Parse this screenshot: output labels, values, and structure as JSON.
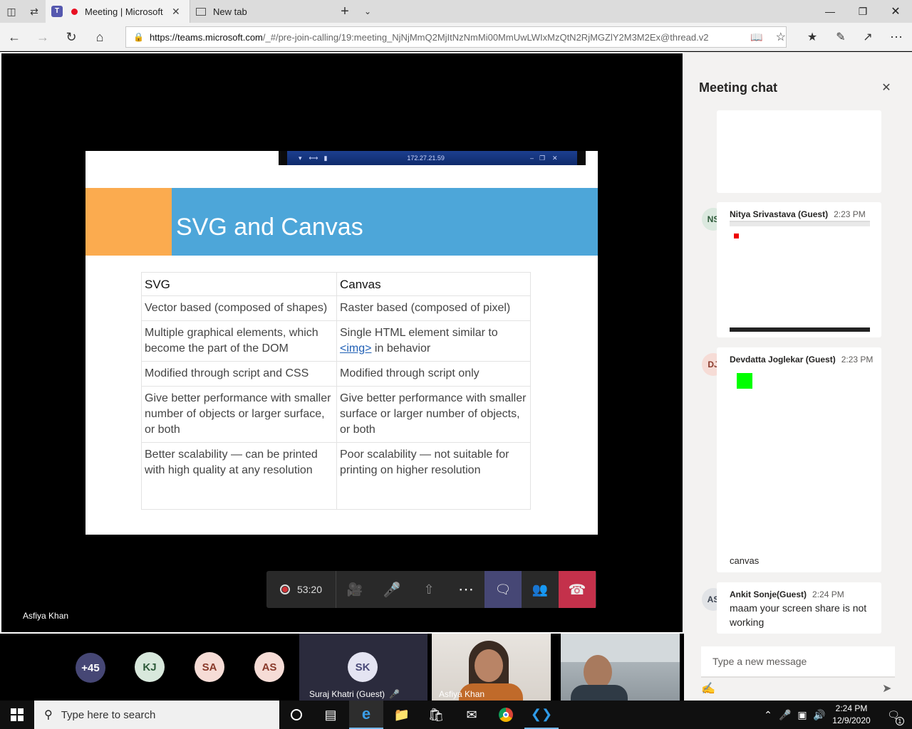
{
  "browser": {
    "tabs": [
      {
        "label": "Meeting | Microsoft Teams",
        "active": true
      },
      {
        "label": "New tab",
        "active": false
      }
    ],
    "url_host": "https://teams.microsoft.com",
    "url_path": "/_#/pre-join-calling/19:meeting_NjNjMmQ2MjItNzNmMi00MmUwLWIxMzQtN2RjMGZlY2M3M2Ex@thread.v2"
  },
  "slide": {
    "remote_ip": "172.27.21.59",
    "title": "SVG and Canvas",
    "table": {
      "headers": [
        "SVG",
        "Canvas"
      ],
      "rows": [
        [
          "Vector based (composed of shapes)",
          "Raster based (composed of pixel)"
        ],
        [
          "Multiple graphical elements, which become the part of the DOM",
          "Single HTML element similar to"
        ],
        [
          "Modified through script and CSS",
          "Modified through script only"
        ],
        [
          "Give better performance with smaller number of objects or larger surface, or both",
          "Give better performance with smaller surface or larger number of objects, or both"
        ],
        [
          "Better scalability — can be printed with high quality at any resolution",
          "Poor scalability — not suitable for printing on higher resolution"
        ]
      ],
      "img_link": "<img>",
      "img_suffix": " in behavior"
    }
  },
  "call": {
    "timer": "53:20",
    "presenter": "Asfiya Khan"
  },
  "participants": {
    "overflow": "+45",
    "avatars": [
      "KJ",
      "SA",
      "AS"
    ],
    "tiles": [
      {
        "initials": "SK",
        "name": "Suraj Khatri (Guest)"
      },
      {
        "name": "Asfiya Khan"
      }
    ]
  },
  "chat": {
    "title": "Meeting chat",
    "messages": [
      {
        "initials": "NS",
        "author": "Nitya Srivastava (Guest)",
        "time": "2:23 PM"
      },
      {
        "initials": "DJ",
        "author": "Devdatta Joglekar (Guest)",
        "time": "2:23 PM",
        "text": "canvas"
      },
      {
        "initials": "AS",
        "author": "Ankit Sonje(Guest)",
        "time": "2:24 PM",
        "text": "maam your screen share is not working"
      }
    ],
    "compose_placeholder": "Type a new message"
  },
  "taskbar": {
    "search_placeholder": "Type here to search",
    "time": "2:24 PM",
    "date": "12/9/2020",
    "notifications": "1"
  },
  "colors": {
    "teams_purple": "#464775",
    "hangup_red": "#c4314b",
    "slide_blue": "#4da6d9",
    "slide_orange": "#fbab4f"
  }
}
